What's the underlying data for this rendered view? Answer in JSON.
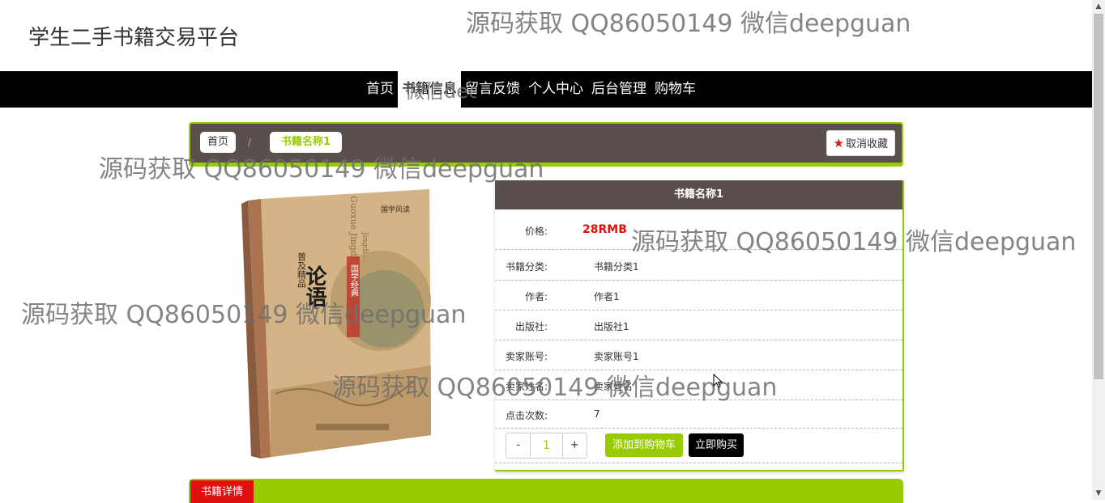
{
  "site": {
    "title": "学生二手书籍交易平台"
  },
  "nav": {
    "items": [
      {
        "label": "首页"
      },
      {
        "label": "书籍信息"
      },
      {
        "label": "留言反馈"
      },
      {
        "label": "个人中心"
      },
      {
        "label": "后台管理"
      },
      {
        "label": "购物车"
      }
    ],
    "active_index": 1
  },
  "breadcrumb": {
    "home": "首页",
    "separator": "/",
    "current": "书籍名称1"
  },
  "favorite_button": {
    "label": "取消收藏",
    "icon": "star-icon"
  },
  "book": {
    "name": "书籍名称1",
    "price_label": "价格:",
    "price": "28RMB",
    "fields": [
      {
        "label": "书籍分类:",
        "value": "书籍分类1"
      },
      {
        "label": "作者:",
        "value": "作者1"
      },
      {
        "label": "出版社:",
        "value": "出版社1"
      },
      {
        "label": "卖家账号:",
        "value": "卖家账号1"
      },
      {
        "label": "卖家姓名:",
        "value": "卖家姓名"
      },
      {
        "label": "点击次数:",
        "value": "7"
      }
    ],
    "cover": {
      "brand": "国学风读",
      "title": "论语",
      "series": "国学经典",
      "edition": "普及精品",
      "pinyin": "Guoxue Jingdian",
      "pinyin_short": "Jingdian"
    }
  },
  "purchase": {
    "minus": "-",
    "quantity": "1",
    "plus": "+",
    "add_to_cart": "添加到购物车",
    "buy_now": "立即购买"
  },
  "details_tab": "书籍详情",
  "watermarks": [
    "源码获取 QQ86050149 微信deepguan",
    "源码获取 QQ86050149 微信deepguan",
    "源码获取 QQ86050149 微信deepguan",
    "源码获取 QQ86050149 微信deepguan",
    "源码获取 QQ86050149 微信deepguan",
    "微信dee"
  ],
  "colors": {
    "accent_green": "#99cc00",
    "header_brown": "#5b4f4e",
    "price_red": "#e01010",
    "nav_black": "#000000"
  }
}
